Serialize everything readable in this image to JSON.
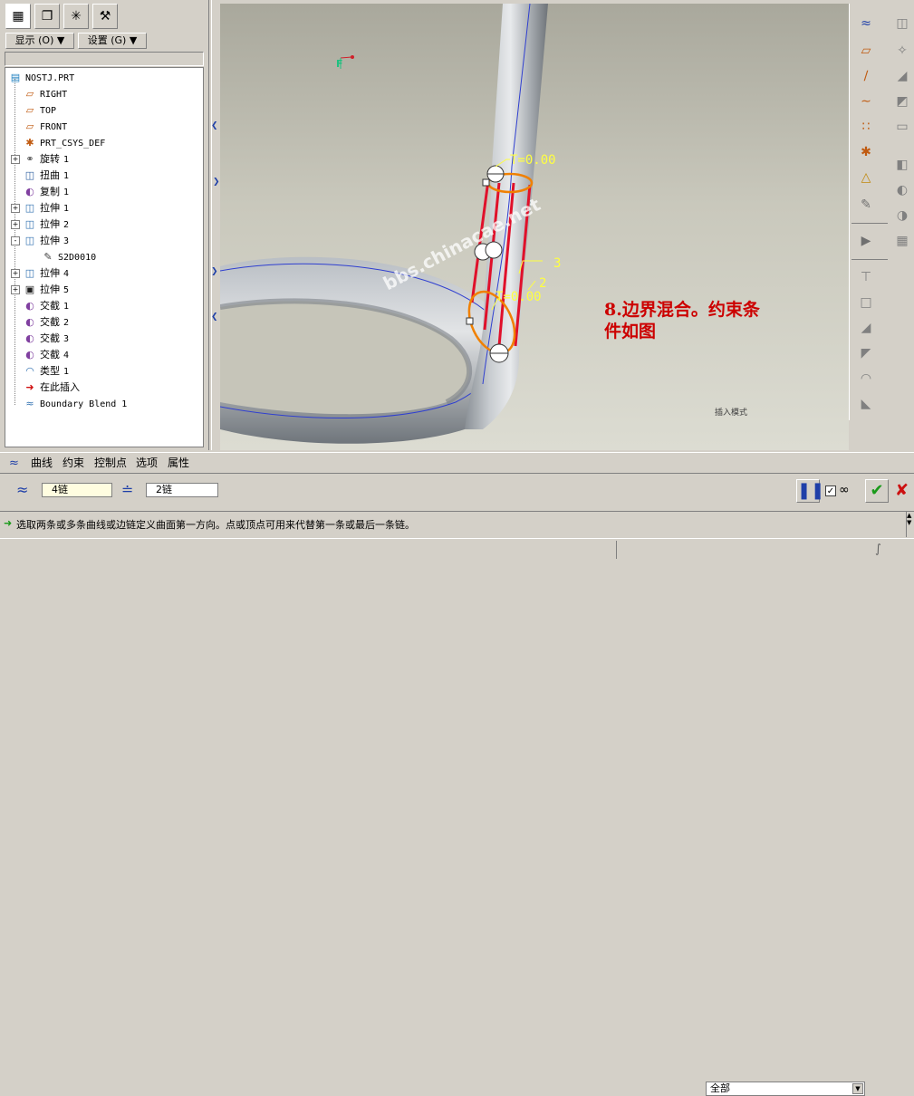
{
  "left_panel": {
    "tabs": [
      "model-tree-icon",
      "layers-icon",
      "favorites-icon",
      "tools-icon"
    ],
    "show_menu": "显示 (O) ▼",
    "settings_menu": "设置 (G) ▼"
  },
  "tree": [
    {
      "label": "NOSTJ.PRT",
      "icon": "part-icon",
      "expand": ""
    },
    {
      "label": "RIGHT",
      "icon": "datum-plane-icon",
      "expand": ""
    },
    {
      "label": "TOP",
      "icon": "datum-plane-icon",
      "expand": ""
    },
    {
      "label": "FRONT",
      "icon": "datum-plane-icon",
      "expand": ""
    },
    {
      "label": "PRT_CSYS_DEF",
      "icon": "csys-icon",
      "expand": ""
    },
    {
      "label": "旋转",
      "num": "1",
      "icon": "revolve-icon",
      "expand": "+"
    },
    {
      "label": "扭曲",
      "num": "1",
      "icon": "warp-icon",
      "expand": ""
    },
    {
      "label": "复制",
      "num": "1",
      "icon": "copy-icon",
      "expand": ""
    },
    {
      "label": "拉伸",
      "num": "1",
      "icon": "extrude-icon",
      "expand": "+"
    },
    {
      "label": "拉伸",
      "num": "2",
      "icon": "extrude-icon",
      "expand": "+"
    },
    {
      "label": "拉伸",
      "num": "3",
      "icon": "extrude-icon",
      "expand": "-"
    },
    {
      "label": "S2D0010",
      "icon": "sketch-icon",
      "expand": "",
      "indent": 1
    },
    {
      "label": "拉伸",
      "num": "4",
      "icon": "extrude-icon",
      "expand": "+"
    },
    {
      "label": "拉伸",
      "num": "5",
      "icon": "extrude-cut-icon",
      "expand": "+"
    },
    {
      "label": "交截",
      "num": "1",
      "icon": "intersect-icon",
      "expand": ""
    },
    {
      "label": "交截",
      "num": "2",
      "icon": "intersect-icon",
      "expand": ""
    },
    {
      "label": "交截",
      "num": "3",
      "icon": "intersect-icon",
      "expand": ""
    },
    {
      "label": "交截",
      "num": "4",
      "icon": "intersect-icon",
      "expand": ""
    },
    {
      "label": "类型",
      "num": "1",
      "icon": "surface-icon",
      "expand": ""
    },
    {
      "label": "在此插入",
      "icon": "insert-arrow-icon",
      "expand": ""
    },
    {
      "label": "Boundary Blend 1",
      "icon": "boundary-blend-icon",
      "expand": ""
    }
  ],
  "viewport": {
    "t_label_top": "T=0.00",
    "t_label_bottom": "T=0.00",
    "chain_label_3": "3",
    "chain_label_2": "2",
    "watermark": "bbs.chinacae.net",
    "annotation_line1": "8.边界混合。约束条",
    "annotation_line2": "件如图",
    "mode_text": "插入模式",
    "csys_label": "F"
  },
  "dashboard": {
    "tabs": [
      "曲线",
      "约束",
      "控制点",
      "选项",
      "属性"
    ],
    "first_direction": "4链",
    "second_direction": "2链"
  },
  "message": "选取两条或多条曲线或边链定义曲面第一方向。点或顶点可用来代替第一条或最后一条链。",
  "status": {
    "filter": "全部"
  },
  "colors": {
    "chain_red": "#e0102a",
    "chain_orange": "#f08000",
    "label_yellow": "#ffff40",
    "annotation_red": "#cc0000"
  }
}
